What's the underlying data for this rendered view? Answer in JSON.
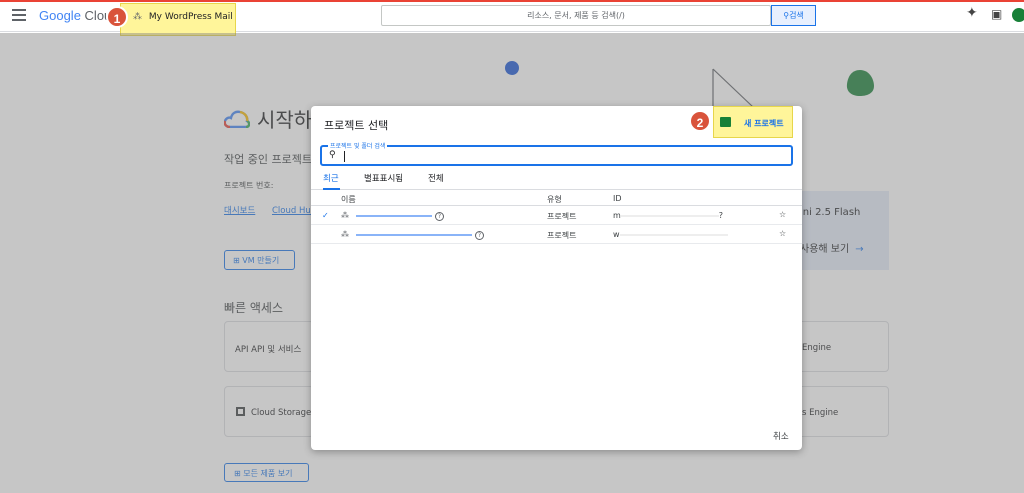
{
  "header": {
    "logo_google": "Google",
    "logo_cloud": "Clou",
    "project_picker_label": "My WordPress Mail",
    "search_placeholder": "리소스, 문서, 제품 등 검색(/)",
    "search_button": "검색",
    "step1_badge": "1"
  },
  "page": {
    "title": "시작하",
    "working_project": "작업 중인 프로젝트",
    "project_number_label": "프로젝트 번호:",
    "links": [
      "대시보드",
      "Cloud Hub"
    ],
    "vm_button": "VM 만들기",
    "quick_access_title": "빠른 액세스",
    "cards": [
      "API API 및 서비스",
      "Cloud Storage",
      "Engine",
      "s Engine"
    ],
    "all_products_button": "모든 제품 보기",
    "gemini_title": "ini 2.5 Flash",
    "gemini_try": "사용해 보기"
  },
  "dialog": {
    "title": "프로젝트 선택",
    "new_project_button": "새 프로젝트",
    "step2_badge": "2",
    "search_field_label": "프로젝트 및 폴더 검색",
    "tabs": [
      "최근",
      "별표표시됨",
      "전체"
    ],
    "columns": {
      "name": "이름",
      "type": "유형",
      "id": "ID"
    },
    "rows": [
      {
        "type": "프로젝트",
        "id_prefix": "m",
        "id_suffix": "?",
        "selected": true
      },
      {
        "type": "프로젝트",
        "id_prefix": "w",
        "id_suffix": "",
        "selected": false
      }
    ],
    "cancel_button": "취소"
  },
  "colors": {
    "accent": "#1a73e8",
    "highlight": "#fff59a",
    "badge": "#d9533b"
  }
}
